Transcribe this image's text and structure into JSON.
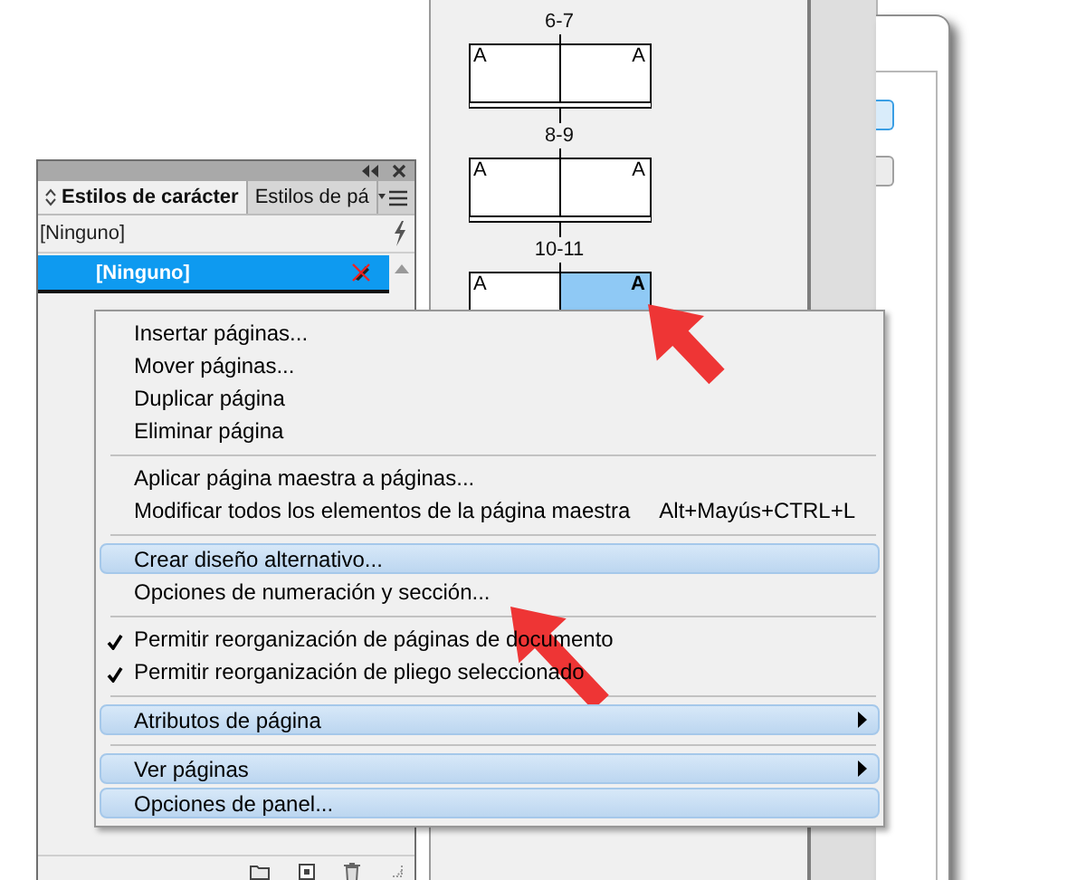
{
  "pages_panel": {
    "spreads": [
      {
        "label": "6-7",
        "pages": [
          {
            "master": "A",
            "selected": false
          },
          {
            "master": "A",
            "selected": false
          }
        ]
      },
      {
        "label": "8-9",
        "pages": [
          {
            "master": "A",
            "selected": false
          },
          {
            "master": "A",
            "selected": false
          }
        ]
      },
      {
        "label": "10-11",
        "pages": [
          {
            "master": "A",
            "selected": false
          },
          {
            "master": "A",
            "selected": true
          }
        ]
      }
    ]
  },
  "styles_panel": {
    "tabs": [
      {
        "label": "Estilos de carácter",
        "selected": true
      },
      {
        "label": "Estilos de pá",
        "selected": false
      }
    ],
    "current_style": "[Ninguno]",
    "styles": [
      {
        "name": "[Ninguno]",
        "selected": true
      }
    ]
  },
  "context_menu": {
    "items": [
      {
        "kind": "item",
        "label": "Insertar páginas...",
        "checked": false,
        "highlighted": false,
        "submenu": false
      },
      {
        "kind": "item",
        "label": "Mover páginas...",
        "checked": false,
        "highlighted": false,
        "submenu": false
      },
      {
        "kind": "item",
        "label": "Duplicar página",
        "checked": false,
        "highlighted": false,
        "submenu": false
      },
      {
        "kind": "item",
        "label": "Eliminar página",
        "checked": false,
        "highlighted": false,
        "submenu": false
      },
      {
        "kind": "separator"
      },
      {
        "kind": "item",
        "label": "Aplicar página maestra a páginas...",
        "checked": false,
        "highlighted": false,
        "submenu": false
      },
      {
        "kind": "item",
        "label": "Modificar todos los elementos de la página maestra",
        "shortcut": "Alt+Mayús+CTRL+L",
        "checked": false,
        "highlighted": false,
        "submenu": false
      },
      {
        "kind": "separator"
      },
      {
        "kind": "item",
        "label": "Crear diseño alternativo...",
        "checked": false,
        "highlighted": true,
        "submenu": false
      },
      {
        "kind": "item",
        "label": "Opciones de numeración y sección...",
        "checked": false,
        "highlighted": false,
        "submenu": false
      },
      {
        "kind": "separator"
      },
      {
        "kind": "item",
        "label": "Permitir reorganización de páginas de documento",
        "checked": true,
        "highlighted": false,
        "submenu": false
      },
      {
        "kind": "item",
        "label": "Permitir reorganización de pliego seleccionado",
        "checked": true,
        "highlighted": false,
        "submenu": false
      },
      {
        "kind": "separator"
      },
      {
        "kind": "item",
        "label": "Atributos de página",
        "checked": false,
        "highlighted": true,
        "submenu": true
      },
      {
        "kind": "separator"
      },
      {
        "kind": "item",
        "label": "Ver páginas",
        "checked": false,
        "highlighted": true,
        "submenu": true
      },
      {
        "kind": "item",
        "label": "Opciones de panel...",
        "checked": false,
        "highlighted": true,
        "submenu": false
      }
    ]
  }
}
